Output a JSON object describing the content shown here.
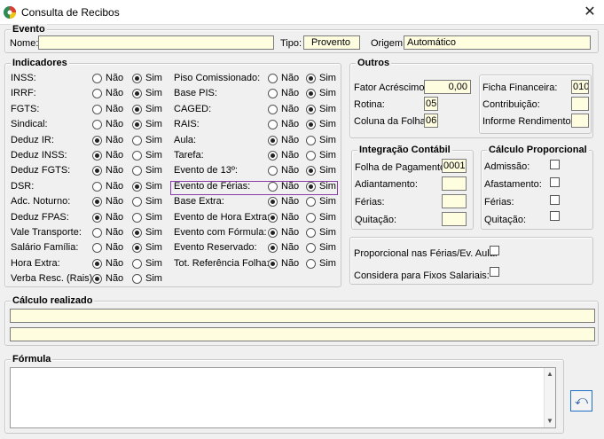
{
  "window": {
    "title": "Consulta de Recibos",
    "close_glyph": "✕"
  },
  "evento": {
    "title": "Evento",
    "nome_label": "Nome:",
    "nome_value": "",
    "tipo_label": "Tipo:",
    "tipo_value": "Provento",
    "origem_label": "Origem:",
    "origem_value": "Automático"
  },
  "indicadores": {
    "title": "Indicadores",
    "nao": "Não",
    "sim": "Sim",
    "left": [
      {
        "label": "INSS:",
        "value": "sim"
      },
      {
        "label": "IRRF:",
        "value": "sim"
      },
      {
        "label": "FGTS:",
        "value": "sim"
      },
      {
        "label": "Sindical:",
        "value": "sim"
      },
      {
        "label": "Deduz IR:",
        "value": "nao"
      },
      {
        "label": "Deduz INSS:",
        "value": "nao"
      },
      {
        "label": "Deduz FGTS:",
        "value": "nao"
      },
      {
        "label": "DSR:",
        "value": "sim"
      },
      {
        "label": "Adc. Noturno:",
        "value": "nao"
      },
      {
        "label": "Deduz FPAS:",
        "value": "nao"
      },
      {
        "label": "Vale Transporte:",
        "value": "sim"
      },
      {
        "label": "Salário Família:",
        "value": "sim"
      },
      {
        "label": "Hora Extra:",
        "value": "nao"
      },
      {
        "label": "Verba Resc. (Rais):",
        "value": "nao"
      }
    ],
    "right": [
      {
        "label": "Piso Comissionado:",
        "value": "sim"
      },
      {
        "label": "Base PIS:",
        "value": "sim"
      },
      {
        "label": "CAGED:",
        "value": "sim"
      },
      {
        "label": "RAIS:",
        "value": "sim"
      },
      {
        "label": "Aula:",
        "value": "nao"
      },
      {
        "label": "Tarefa:",
        "value": "nao"
      },
      {
        "label": "Evento de 13º:",
        "value": "sim"
      },
      {
        "label": "Evento de Férias:",
        "value": "sim"
      },
      {
        "label": "Base Extra:",
        "value": "nao"
      },
      {
        "label": "Evento de Hora Extra:",
        "value": "nao"
      },
      {
        "label": "Evento com Fórmula:",
        "value": "nao"
      },
      {
        "label": "Evento Reservado:",
        "value": "nao"
      },
      {
        "label": "Tot. Referência Folha:",
        "value": "nao"
      }
    ]
  },
  "outros": {
    "title": "Outros",
    "fator_label": "Fator Acréscimo:",
    "fator_value": "0,00",
    "rotina_label": "Rotina:",
    "rotina_value": "05",
    "coluna_label": "Coluna da Folha:",
    "coluna_value": "06",
    "ficha_label": "Ficha Financeira:",
    "ficha_value": "010",
    "contrib_label": "Contribuição:",
    "contrib_value": "",
    "informe_label": "Informe Rendimentos:",
    "informe_value": ""
  },
  "integracao": {
    "title": "Integração Contábil",
    "folha_label": "Folha de Pagamento:",
    "folha_value": "0001",
    "adiant_label": "Adiantamento:",
    "adiant_value": "",
    "ferias_label": "Férias:",
    "ferias_value": "",
    "quit_label": "Quitação:",
    "quit_value": ""
  },
  "proporcional": {
    "title": "Cálculo Proporcional",
    "admissao": "Admissão:",
    "afastamento": "Afastamento:",
    "ferias": "Férias:",
    "quitacao": "Quitação:"
  },
  "extras": {
    "prop_ferias_label": "Proporcional nas Férias/Ev. Aula:",
    "fixos_label": "Considera para Fixos Salariais:"
  },
  "calculo": {
    "title": "Cálculo realizado",
    "line1": "",
    "line2": ""
  },
  "formula": {
    "title": "Fórmula",
    "text": ""
  },
  "undo": {
    "glyph": "⤺"
  }
}
